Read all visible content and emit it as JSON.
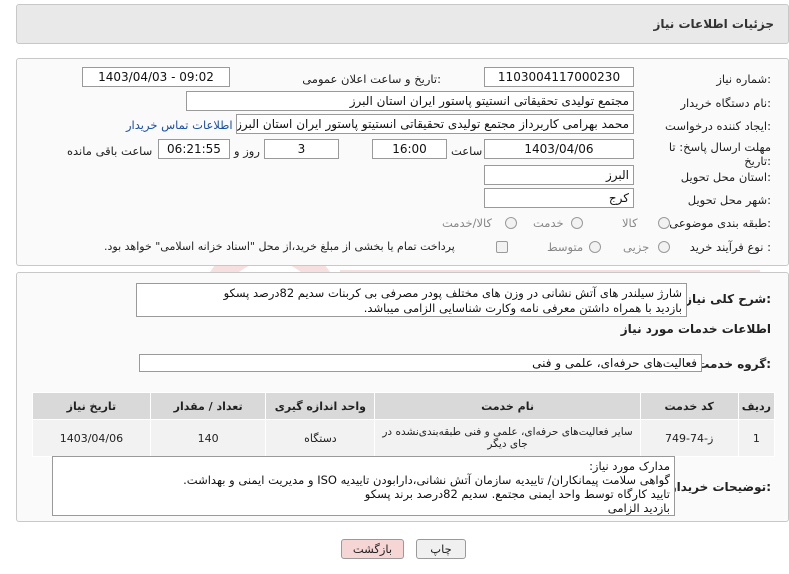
{
  "header": {
    "title": "جزئیات اطلاعات نیاز"
  },
  "fields": {
    "need_number_label": "شماره نیاز:",
    "need_number": "1103004117000230",
    "announce_label": "تاریخ و ساعت اعلان عمومی:",
    "announce_value": "1403/04/03 - 09:02",
    "buyer_label": "نام دستگاه خریدار:",
    "buyer_value": "مجتمع تولیدی تحقیقاتی انستیتو پاستور ایران استان البرز",
    "creator_label": "ایجاد کننده درخواست:",
    "creator_value": "محمد بهرامی کاربرداز مجتمع تولیدی تحقیقاتی انستیتو پاستور ایران استان البرز",
    "contact_link": "اطلاعات تماس خریدار",
    "deadline_label": "مهلت ارسال پاسخ: تا تاریخ:",
    "deadline_date": "1403/04/06",
    "time_label": "ساعت",
    "deadline_time": "16:00",
    "days_value": "3",
    "days_label": "روز و",
    "remaining_time": "06:21:55",
    "remaining_label": "ساعت باقی مانده",
    "province_label": "استان محل تحویل:",
    "province_value": "البرز",
    "city_label": "شهر محل تحویل:",
    "city_value": "کرج",
    "category_label": "طبقه بندی موضوعی:",
    "category_options": [
      "کالا",
      "خدمت",
      "کالا/خدمت"
    ],
    "process_label": "نوع فرآیند خرید :",
    "process_options": [
      "جزیی",
      "متوسط"
    ],
    "payment_note": "پرداخت تمام یا بخشی از مبلغ خرید،از محل \"اسناد خزانه اسلامی\" خواهد بود."
  },
  "description": {
    "label": "شرح کلی نیاز:",
    "line1": "شارژ سیلندر های آتش نشانی در وزن های مختلف پودر مصرفی بی کربنات سدیم 82درصد پسکو",
    "line2": "بازدید با همراه داشتن معرفی نامه وکارت شناسایی الزامی میباشد."
  },
  "services": {
    "section_title": "اطلاعات خدمات مورد نیاز",
    "group_label": "گروه خدمت:",
    "group_value": "فعالیت‌های حرفه‌ای، علمی و فنی",
    "columns": [
      "ردیف",
      "کد خدمت",
      "نام خدمت",
      "واحد اندازه گیری",
      "تعداد / مقدار",
      "تاریخ نیاز"
    ],
    "rows": [
      [
        "1",
        "ز-74-749",
        "سایر فعالیت‌های حرفه‌ای، علمی و فنی طبقه‌بندی‌نشده در جای دیگر",
        "دستگاه",
        "140",
        "1403/04/06"
      ]
    ]
  },
  "buyer_notes": {
    "label": "توضیحات خریدار:",
    "line1": "مدارک مورد نیاز:",
    "line2": "گواهی سلامت پیمانکاران/ تاییدیه سازمان آتش نشانی،دارابودن  تاییدیه ISO و مدیریت ایمنی و بهداشت.",
    "line3": "تایید کارگاه توسط واحد ایمنی مجتمع. سدیم 82درصد برند پسکو",
    "line4": "بازدید الزامی"
  },
  "buttons": {
    "print": "چاپ",
    "back": "بازگشت"
  },
  "colors": {
    "back_button_bg": "#f6d5d5",
    "link": "#1a4fa3"
  }
}
